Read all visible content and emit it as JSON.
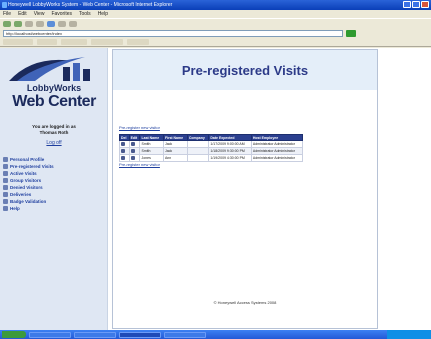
{
  "header": {
    "title": "Pre-registered Visits"
  },
  "logo": {
    "small": "LobbyWorks",
    "big": "Web Center"
  },
  "session": {
    "logged_in_as": "You are logged in as",
    "user": "Thomas Roth",
    "logoff": "Log off"
  },
  "nav": [
    {
      "label": "Personal Profile"
    },
    {
      "label": "Pre-registered Visits"
    },
    {
      "label": "Active Visits"
    },
    {
      "label": "Group Visitors"
    },
    {
      "label": "Denied Visitors"
    },
    {
      "label": "Deliveries"
    },
    {
      "label": "Badge Validation"
    },
    {
      "label": "Help"
    }
  ],
  "grid": {
    "link_top": "Pre-register new visitor",
    "link_bottom": "Pre-register new visitor",
    "columns": [
      "Del",
      "Edit",
      "Last Name",
      "First Name",
      "Company",
      "Date Expected",
      "Host Employee"
    ],
    "rows": [
      {
        "last": "Smith",
        "first": "Jack",
        "company": "",
        "date": "1/17/2009 9:00:00 AM",
        "host": "Administrator Administrator"
      },
      {
        "last": "Smith",
        "first": "Jack",
        "company": "",
        "date": "1/18/2009 9:30:00 PM",
        "host": "Administrator Administrator"
      },
      {
        "last": "Jones",
        "first": "Ann",
        "company": "",
        "date": "1/19/2009 4:30:00 PM",
        "host": "Administrator Administrator"
      }
    ]
  },
  "footer": "© Honeywell Access Systems 2008",
  "browser": {
    "title": "Honeywell LobbyWorks System - Web Center - Microsoft Internet Explorer",
    "menu": [
      "File",
      "Edit",
      "View",
      "Favorites",
      "Tools",
      "Help"
    ],
    "address": "http://localhost/webcenter/index"
  }
}
